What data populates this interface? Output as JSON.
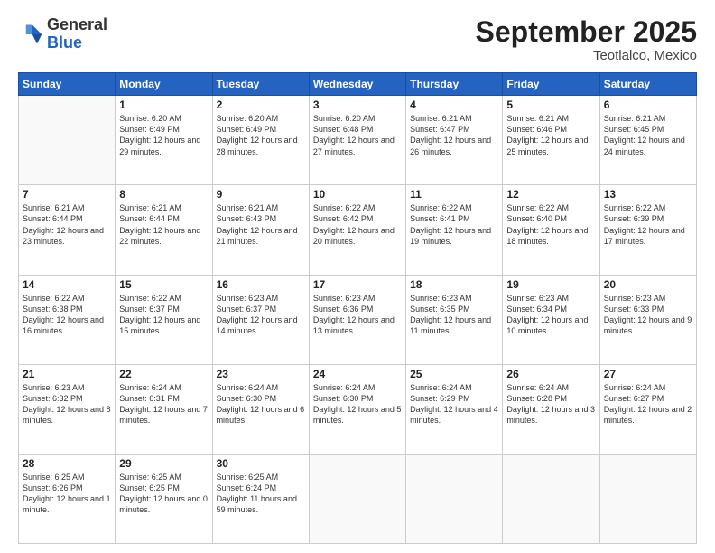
{
  "logo": {
    "general": "General",
    "blue": "Blue"
  },
  "title": {
    "month_year": "September 2025",
    "location": "Teotlalco, Mexico"
  },
  "header_days": [
    "Sunday",
    "Monday",
    "Tuesday",
    "Wednesday",
    "Thursday",
    "Friday",
    "Saturday"
  ],
  "weeks": [
    [
      {
        "day": "",
        "sunrise": "",
        "sunset": "",
        "daylight": ""
      },
      {
        "day": "1",
        "sunrise": "Sunrise: 6:20 AM",
        "sunset": "Sunset: 6:49 PM",
        "daylight": "Daylight: 12 hours and 29 minutes."
      },
      {
        "day": "2",
        "sunrise": "Sunrise: 6:20 AM",
        "sunset": "Sunset: 6:49 PM",
        "daylight": "Daylight: 12 hours and 28 minutes."
      },
      {
        "day": "3",
        "sunrise": "Sunrise: 6:20 AM",
        "sunset": "Sunset: 6:48 PM",
        "daylight": "Daylight: 12 hours and 27 minutes."
      },
      {
        "day": "4",
        "sunrise": "Sunrise: 6:21 AM",
        "sunset": "Sunset: 6:47 PM",
        "daylight": "Daylight: 12 hours and 26 minutes."
      },
      {
        "day": "5",
        "sunrise": "Sunrise: 6:21 AM",
        "sunset": "Sunset: 6:46 PM",
        "daylight": "Daylight: 12 hours and 25 minutes."
      },
      {
        "day": "6",
        "sunrise": "Sunrise: 6:21 AM",
        "sunset": "Sunset: 6:45 PM",
        "daylight": "Daylight: 12 hours and 24 minutes."
      }
    ],
    [
      {
        "day": "7",
        "sunrise": "Sunrise: 6:21 AM",
        "sunset": "Sunset: 6:44 PM",
        "daylight": "Daylight: 12 hours and 23 minutes."
      },
      {
        "day": "8",
        "sunrise": "Sunrise: 6:21 AM",
        "sunset": "Sunset: 6:44 PM",
        "daylight": "Daylight: 12 hours and 22 minutes."
      },
      {
        "day": "9",
        "sunrise": "Sunrise: 6:21 AM",
        "sunset": "Sunset: 6:43 PM",
        "daylight": "Daylight: 12 hours and 21 minutes."
      },
      {
        "day": "10",
        "sunrise": "Sunrise: 6:22 AM",
        "sunset": "Sunset: 6:42 PM",
        "daylight": "Daylight: 12 hours and 20 minutes."
      },
      {
        "day": "11",
        "sunrise": "Sunrise: 6:22 AM",
        "sunset": "Sunset: 6:41 PM",
        "daylight": "Daylight: 12 hours and 19 minutes."
      },
      {
        "day": "12",
        "sunrise": "Sunrise: 6:22 AM",
        "sunset": "Sunset: 6:40 PM",
        "daylight": "Daylight: 12 hours and 18 minutes."
      },
      {
        "day": "13",
        "sunrise": "Sunrise: 6:22 AM",
        "sunset": "Sunset: 6:39 PM",
        "daylight": "Daylight: 12 hours and 17 minutes."
      }
    ],
    [
      {
        "day": "14",
        "sunrise": "Sunrise: 6:22 AM",
        "sunset": "Sunset: 6:38 PM",
        "daylight": "Daylight: 12 hours and 16 minutes."
      },
      {
        "day": "15",
        "sunrise": "Sunrise: 6:22 AM",
        "sunset": "Sunset: 6:37 PM",
        "daylight": "Daylight: 12 hours and 15 minutes."
      },
      {
        "day": "16",
        "sunrise": "Sunrise: 6:23 AM",
        "sunset": "Sunset: 6:37 PM",
        "daylight": "Daylight: 12 hours and 14 minutes."
      },
      {
        "day": "17",
        "sunrise": "Sunrise: 6:23 AM",
        "sunset": "Sunset: 6:36 PM",
        "daylight": "Daylight: 12 hours and 13 minutes."
      },
      {
        "day": "18",
        "sunrise": "Sunrise: 6:23 AM",
        "sunset": "Sunset: 6:35 PM",
        "daylight": "Daylight: 12 hours and 11 minutes."
      },
      {
        "day": "19",
        "sunrise": "Sunrise: 6:23 AM",
        "sunset": "Sunset: 6:34 PM",
        "daylight": "Daylight: 12 hours and 10 minutes."
      },
      {
        "day": "20",
        "sunrise": "Sunrise: 6:23 AM",
        "sunset": "Sunset: 6:33 PM",
        "daylight": "Daylight: 12 hours and 9 minutes."
      }
    ],
    [
      {
        "day": "21",
        "sunrise": "Sunrise: 6:23 AM",
        "sunset": "Sunset: 6:32 PM",
        "daylight": "Daylight: 12 hours and 8 minutes."
      },
      {
        "day": "22",
        "sunrise": "Sunrise: 6:24 AM",
        "sunset": "Sunset: 6:31 PM",
        "daylight": "Daylight: 12 hours and 7 minutes."
      },
      {
        "day": "23",
        "sunrise": "Sunrise: 6:24 AM",
        "sunset": "Sunset: 6:30 PM",
        "daylight": "Daylight: 12 hours and 6 minutes."
      },
      {
        "day": "24",
        "sunrise": "Sunrise: 6:24 AM",
        "sunset": "Sunset: 6:30 PM",
        "daylight": "Daylight: 12 hours and 5 minutes."
      },
      {
        "day": "25",
        "sunrise": "Sunrise: 6:24 AM",
        "sunset": "Sunset: 6:29 PM",
        "daylight": "Daylight: 12 hours and 4 minutes."
      },
      {
        "day": "26",
        "sunrise": "Sunrise: 6:24 AM",
        "sunset": "Sunset: 6:28 PM",
        "daylight": "Daylight: 12 hours and 3 minutes."
      },
      {
        "day": "27",
        "sunrise": "Sunrise: 6:24 AM",
        "sunset": "Sunset: 6:27 PM",
        "daylight": "Daylight: 12 hours and 2 minutes."
      }
    ],
    [
      {
        "day": "28",
        "sunrise": "Sunrise: 6:25 AM",
        "sunset": "Sunset: 6:26 PM",
        "daylight": "Daylight: 12 hours and 1 minute."
      },
      {
        "day": "29",
        "sunrise": "Sunrise: 6:25 AM",
        "sunset": "Sunset: 6:25 PM",
        "daylight": "Daylight: 12 hours and 0 minutes."
      },
      {
        "day": "30",
        "sunrise": "Sunrise: 6:25 AM",
        "sunset": "Sunset: 6:24 PM",
        "daylight": "Daylight: 11 hours and 59 minutes."
      },
      {
        "day": "",
        "sunrise": "",
        "sunset": "",
        "daylight": ""
      },
      {
        "day": "",
        "sunrise": "",
        "sunset": "",
        "daylight": ""
      },
      {
        "day": "",
        "sunrise": "",
        "sunset": "",
        "daylight": ""
      },
      {
        "day": "",
        "sunrise": "",
        "sunset": "",
        "daylight": ""
      }
    ]
  ]
}
